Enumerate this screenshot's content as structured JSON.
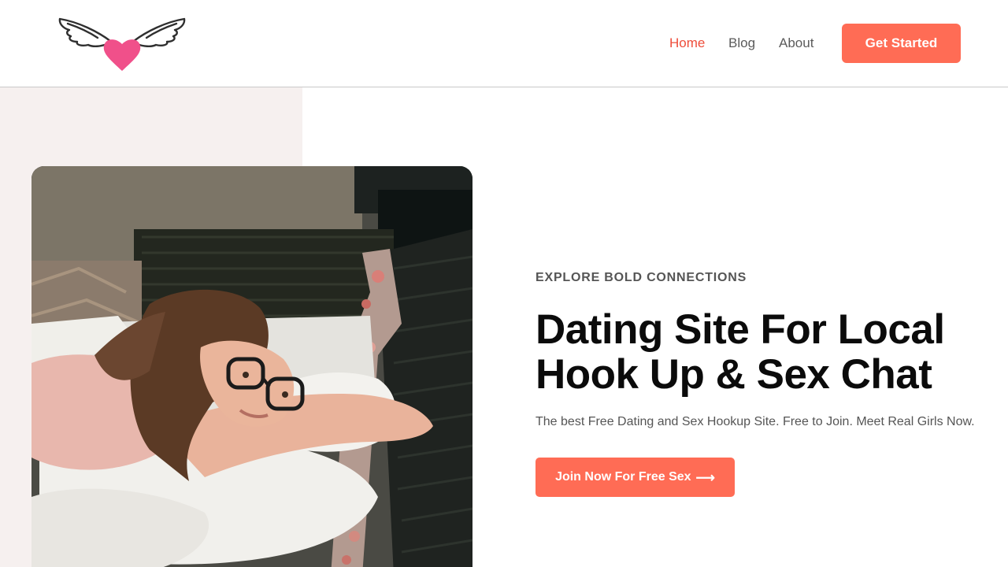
{
  "header": {
    "nav": [
      {
        "label": "Home",
        "active": true
      },
      {
        "label": "Blog"
      },
      {
        "label": "About"
      }
    ],
    "cta_label": "Get Started"
  },
  "hero": {
    "eyebrow": "EXPLORE BOLD CONNECTIONS",
    "headline_line1": "Dating Site For Local",
    "headline_line2": "Hook Up & Sex Chat",
    "subtext": "The best Free Dating and Sex Hookup Site. Free to Join. Meet Real Girls Now.",
    "cta_label": "Join Now For Free Sex",
    "cta_icon": "arrow-right-icon"
  },
  "colors": {
    "accent": "#ff6c55",
    "nav_active": "#ee4d3a",
    "logo_heart": "#f0508a",
    "panel_bg": "#f6f0ef"
  }
}
